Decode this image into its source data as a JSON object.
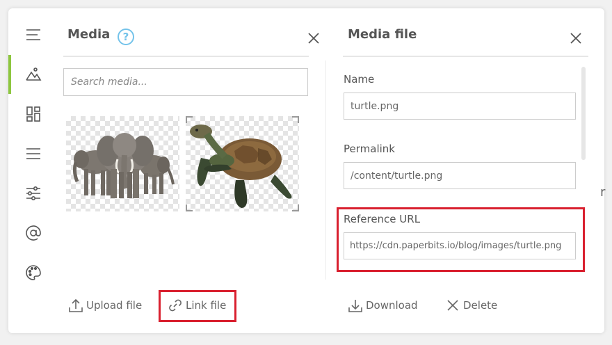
{
  "toolbar": {
    "items": [
      {
        "name": "menu-icon",
        "active": false
      },
      {
        "name": "media-icon",
        "active": true
      },
      {
        "name": "layout-icon",
        "active": false
      },
      {
        "name": "list-icon",
        "active": false
      },
      {
        "name": "settings-sliders-icon",
        "active": false
      },
      {
        "name": "at-sign-icon",
        "active": false
      },
      {
        "name": "palette-icon",
        "active": false
      }
    ],
    "active_color": "#8dc63f"
  },
  "media": {
    "title": "Media",
    "help": "?",
    "search_placeholder": "Search media...",
    "items": [
      {
        "name": "elephant-image",
        "selected": false
      },
      {
        "name": "turtle-image",
        "selected": true
      }
    ],
    "upload_label": "Upload file",
    "link_label": "Link file"
  },
  "file": {
    "title": "Media file",
    "name_label": "Name",
    "name_value": "turtle.png",
    "permalink_label": "Permalink",
    "permalink_value": "/content/turtle.png",
    "reference_label": "Reference URL",
    "reference_value": "https://cdn.paperbits.io/blog/images/turtle.png",
    "download_label": "Download",
    "delete_label": "Delete"
  },
  "edge_text": "r",
  "colors": {
    "highlight": "#d9202f",
    "help": "#74c3ea"
  }
}
